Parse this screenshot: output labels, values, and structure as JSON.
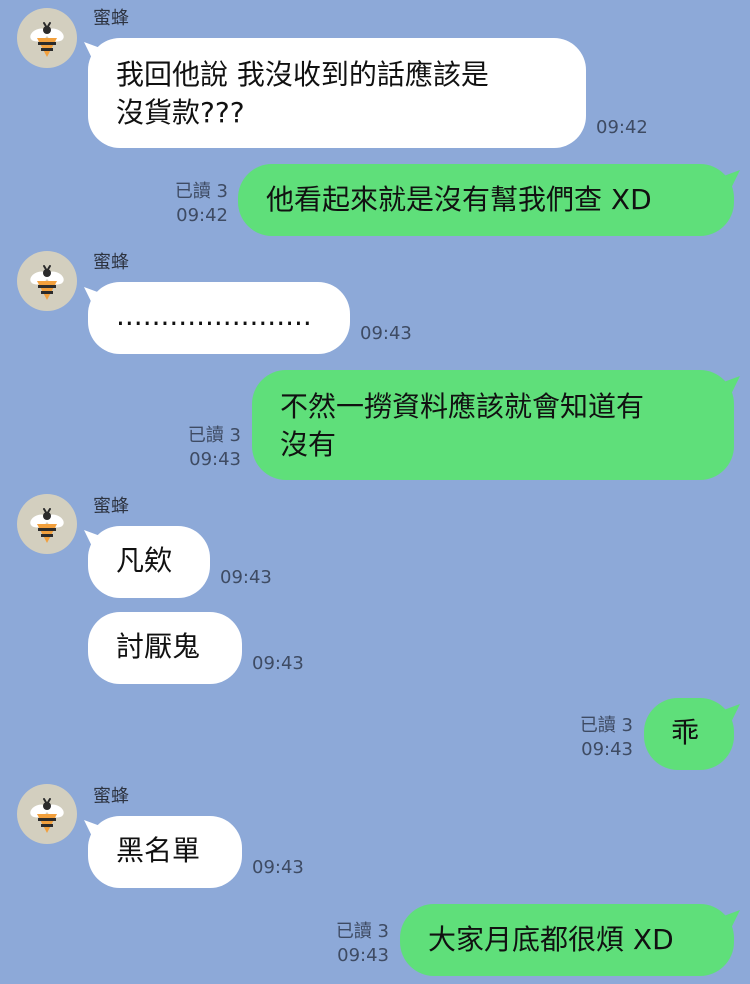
{
  "sender_name": "蜜蜂",
  "read_label": "已讀 3",
  "messages": [
    {
      "lines": [
        "我回他說  我沒收到的話應該是",
        "沒貨款???"
      ],
      "time": "09:42"
    },
    {
      "text": "他看起來就是沒有幫我們查 XD",
      "time": "09:42"
    },
    {
      "text": "......................",
      "time": "09:43"
    },
    {
      "lines": [
        "不然一撈資料應該就會知道有",
        "沒有"
      ],
      "time": "09:43"
    },
    {
      "text": "凡欸",
      "time": "09:43"
    },
    {
      "text": "討厭鬼",
      "time": "09:43"
    },
    {
      "text": "乖",
      "time": "09:43"
    },
    {
      "text": "黑名單",
      "time": "09:43"
    },
    {
      "text": "大家月底都很煩 XD",
      "time": "09:43"
    }
  ],
  "colors": {
    "background": "#8DA9D8",
    "incoming_bubble": "#FFFFFF",
    "outgoing_bubble": "#5FDF7A"
  },
  "icons": {
    "avatar": "bee-icon"
  }
}
